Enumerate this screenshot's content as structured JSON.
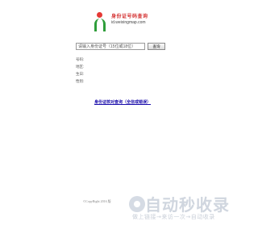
{
  "logo": {
    "title": "身份证号码查询",
    "url": "id.weixingmap.com"
  },
  "search": {
    "input_value": "请输入身份证号（15位或18位）",
    "button_label": "查询"
  },
  "info_fields": [
    {
      "label": "号码:"
    },
    {
      "label": "地区:"
    },
    {
      "label": "生日:"
    },
    {
      "label": "性别:"
    }
  ],
  "notice_link": "身份证核对查询（全信或错误）",
  "footer": {
    "copyright": "©CopyRight 2016 版"
  },
  "watermark": {
    "title": "自动秒收录",
    "subtitle": "做上链接→来访一次→自动收录"
  },
  "colors": {
    "logo_red": "#d32f2f",
    "logo_green": "#2e9d3a",
    "link_blue": "#1a0dab"
  }
}
